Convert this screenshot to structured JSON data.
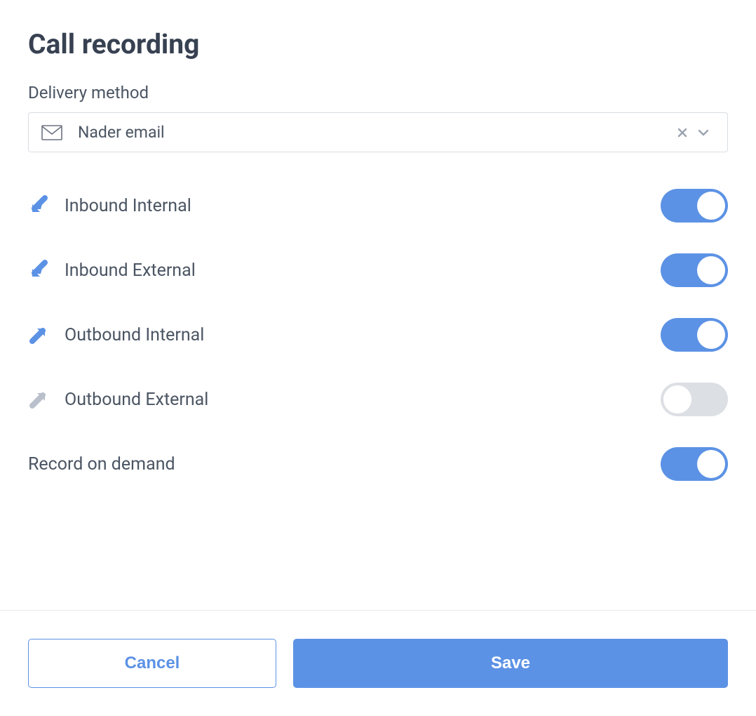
{
  "title": "Call recording",
  "delivery": {
    "label": "Delivery method",
    "selected": "Nader email"
  },
  "options": [
    {
      "key": "inbound_internal",
      "label": "Inbound Internal",
      "direction": "in",
      "enabled": true
    },
    {
      "key": "inbound_external",
      "label": "Inbound External",
      "direction": "in",
      "enabled": true
    },
    {
      "key": "outbound_internal",
      "label": "Outbound Internal",
      "direction": "out",
      "enabled": true
    },
    {
      "key": "outbound_external",
      "label": "Outbound External",
      "direction": "out",
      "enabled": false
    }
  ],
  "record_on_demand": {
    "label": "Record on demand",
    "enabled": true
  },
  "buttons": {
    "cancel": "Cancel",
    "save": "Save"
  },
  "colors": {
    "accent": "#5c92e5",
    "muted_icon": "#b9c0cb"
  }
}
